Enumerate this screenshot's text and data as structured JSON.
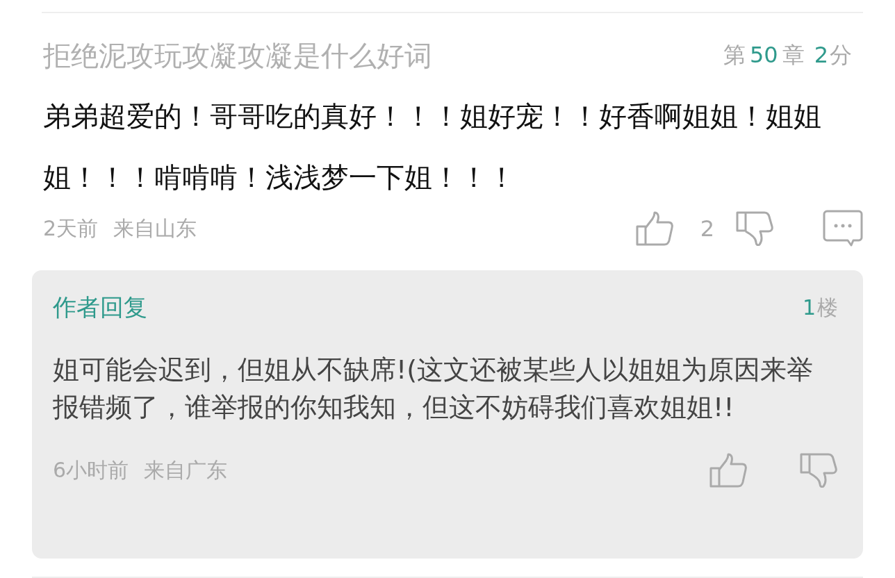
{
  "comment": {
    "title": "拒绝泥攻玩攻凝攻凝是什么好词",
    "chapter": {
      "prefix": "第",
      "number": "50",
      "suffix": "章"
    },
    "score": {
      "number": "2",
      "unit": "分"
    },
    "text": "弟弟超爱的！哥哥吃的真好！！！姐好宠！！好香啊姐姐！姐姐姐！！！啃啃啃！浅浅梦一下姐！！！",
    "time": "2天前",
    "location": "来自山东",
    "likes": "2"
  },
  "reply": {
    "label": "作者回复",
    "floor": {
      "number": "1",
      "unit": "楼"
    },
    "text": "姐可能会迟到，但姐从不缺席!(这文还被某些人以姐姐为原因来举报错频了，谁举报的你知我知，但这不妨碍我们喜欢姐姐!!",
    "time": "6小时前",
    "location": "来自广东"
  }
}
